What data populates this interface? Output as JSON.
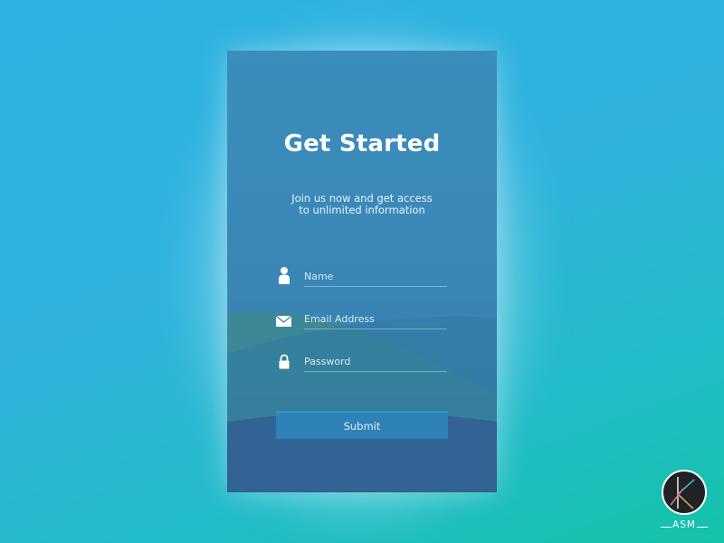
{
  "card": {
    "title": "Get Started",
    "subtitle_line1": "Join us now and get access",
    "subtitle_line2": "to unlimited information"
  },
  "form": {
    "fields": [
      {
        "icon": "user-icon",
        "placeholder": "Name"
      },
      {
        "icon": "envelope-icon",
        "placeholder": "Email Address"
      },
      {
        "icon": "lock-icon",
        "placeholder": "Password"
      }
    ],
    "submit_label": "Submit"
  },
  "watermark": {
    "text": "ASM"
  },
  "colors": {
    "background_top": "#2cb2e0",
    "background_bottom": "#14c2a8",
    "card": "#3a8dbc",
    "wave_green": "#3a8a94",
    "submit_button": "#2e82b8",
    "text": "#ffffff"
  }
}
